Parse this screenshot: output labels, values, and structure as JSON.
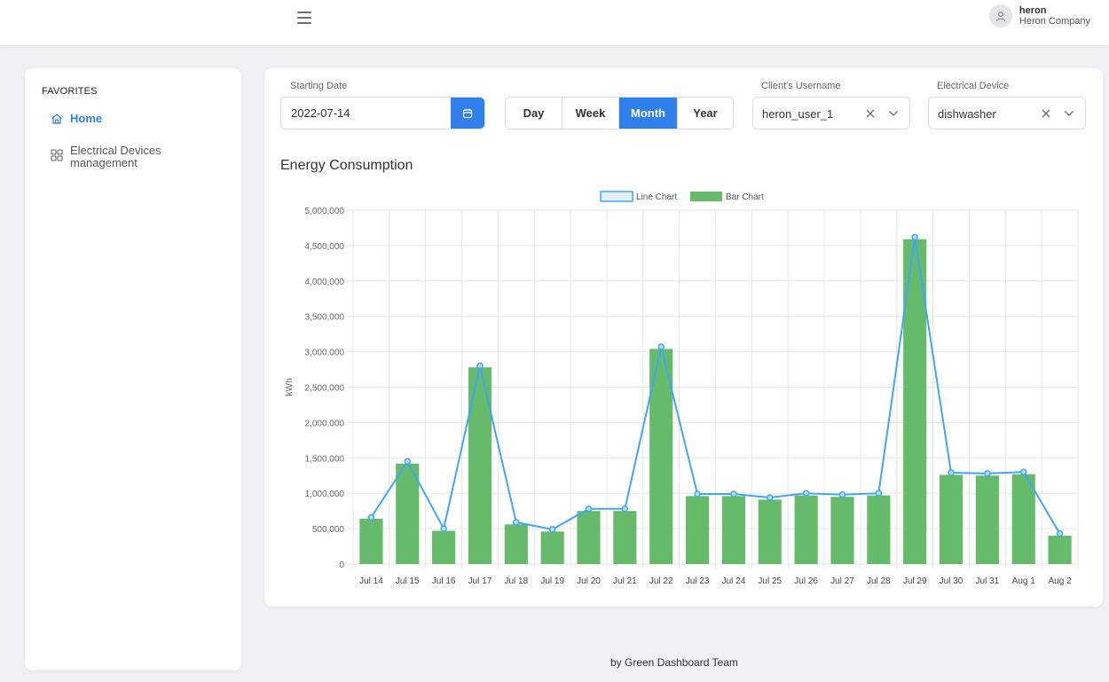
{
  "header": {
    "user_name": "heron",
    "company": "Heron Company"
  },
  "sidebar": {
    "heading": "FAVORITES",
    "items": [
      {
        "label": "Home",
        "icon": "home-icon",
        "active": true
      },
      {
        "label_line1": "Electrical Devices",
        "label_line2": "management",
        "icon": "grid-icon"
      }
    ]
  },
  "filters": {
    "starting_date": {
      "label": "Starting Date",
      "value": "2022-07-14"
    },
    "periods": [
      "Day",
      "Week",
      "Month",
      "Year"
    ],
    "active_period": "Month",
    "username": {
      "label": "Client's Username",
      "value": "heron_user_1"
    },
    "device": {
      "label": "Electrical Device",
      "value": "dishwasher"
    }
  },
  "section_title": "Energy Consumption",
  "colors": {
    "accent": "#2f80ed",
    "bar": "#66bb6a",
    "line": "#42a5f5"
  },
  "chart_data": {
    "type": "bar",
    "categories": [
      "Jul 14",
      "Jul 15",
      "Jul 16",
      "Jul 17",
      "Jul 18",
      "Jul 19",
      "Jul 20",
      "Jul 21",
      "Jul 22",
      "Jul 23",
      "Jul 24",
      "Jul 25",
      "Jul 26",
      "Jul 27",
      "Jul 28",
      "Jul 29",
      "Jul 30",
      "Jul 31",
      "Aug 1",
      "Aug 2"
    ],
    "series": [
      {
        "name": "Line Chart",
        "type": "line",
        "values": [
          660000,
          1450000,
          500000,
          2800000,
          590000,
          490000,
          780000,
          780000,
          3070000,
          990000,
          990000,
          940000,
          1000000,
          980000,
          1000000,
          4620000,
          1290000,
          1280000,
          1300000,
          430000
        ]
      },
      {
        "name": "Bar Chart",
        "type": "bar",
        "values": [
          640000,
          1420000,
          470000,
          2780000,
          560000,
          460000,
          750000,
          750000,
          3040000,
          960000,
          960000,
          910000,
          970000,
          950000,
          970000,
          4590000,
          1260000,
          1250000,
          1270000,
          400000
        ]
      }
    ],
    "ylabel": "kWh",
    "ylim": [
      0,
      5000000
    ],
    "yticks": [
      "0",
      "500,000",
      "1,000,000",
      "1,500,000",
      "2,000,000",
      "2,500,000",
      "3,000,000",
      "3,500,000",
      "4,000,000",
      "4,500,000",
      "5,000,000"
    ],
    "grid": true,
    "legend": "top-center"
  },
  "footer": "by  Green Dashboard Team"
}
